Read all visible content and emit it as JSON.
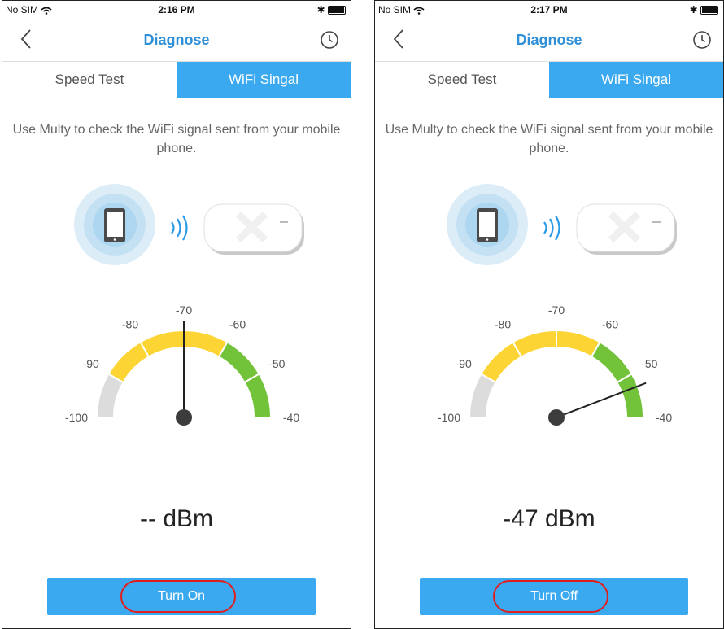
{
  "screens": [
    {
      "status": {
        "carrier": "No SIM",
        "time": "2:16 PM"
      },
      "nav": {
        "title": "Diagnose"
      },
      "tabs": {
        "speed_test": "Speed Test",
        "wifi_signal": "WiFi Singal"
      },
      "description": "Use Multy to check the WiFi signal sent from your mobile phone.",
      "gauge": {
        "ticks": [
          "-100",
          "-90",
          "-80",
          "-70",
          "-60",
          "-50",
          "-40"
        ],
        "needle_value": -70
      },
      "reading": "-- dBm",
      "button": {
        "label": "Turn On"
      }
    },
    {
      "status": {
        "carrier": "No SIM",
        "time": "2:17 PM"
      },
      "nav": {
        "title": "Diagnose"
      },
      "tabs": {
        "speed_test": "Speed Test",
        "wifi_signal": "WiFi Singal"
      },
      "description": "Use Multy to check the WiFi signal sent from your mobile phone.",
      "gauge": {
        "ticks": [
          "-100",
          "-90",
          "-80",
          "-70",
          "-60",
          "-50",
          "-40"
        ],
        "needle_value": -47
      },
      "reading": "-47 dBm",
      "button": {
        "label": "Turn Off"
      }
    }
  ],
  "colors": {
    "accent": "#3ba9ef",
    "title": "#2f8fd8",
    "gauge_grey": "#dcdcdc",
    "gauge_yellow": "#fcd434",
    "gauge_green": "#72c23a",
    "highlight": "#e01e1e"
  },
  "icons": {
    "back": "chevron-left-icon",
    "history": "clock-icon",
    "wifi": "wifi-waves-icon",
    "phone": "mobile-phone-icon"
  }
}
